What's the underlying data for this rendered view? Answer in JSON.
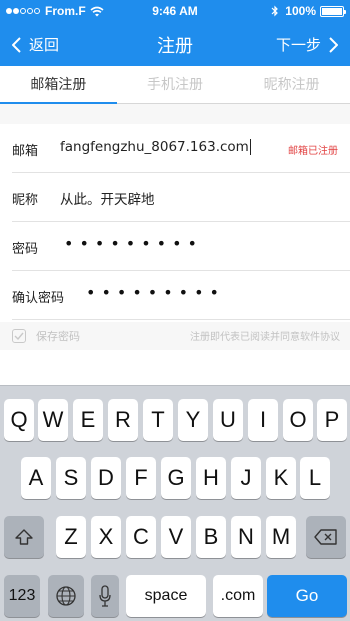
{
  "status_bar": {
    "carrier": "From.F",
    "time": "9:46 AM",
    "battery": "100%"
  },
  "nav": {
    "back_label": "返回",
    "title": "注册",
    "next_label": "下一步"
  },
  "tabs": [
    {
      "label": "邮箱注册",
      "active": true
    },
    {
      "label": "手机注册",
      "active": false
    },
    {
      "label": "昵称注册",
      "active": false
    }
  ],
  "form": {
    "email": {
      "label": "邮箱",
      "value": "fangfengzhu_8067.163.com",
      "error": "邮箱已注册"
    },
    "nickname": {
      "label": "昵称",
      "value": "从此。开天辟地"
    },
    "password": {
      "label": "密码",
      "value": "•••••••••"
    },
    "confirm": {
      "label": "确认密码",
      "value": "•••••••••"
    }
  },
  "save_password": {
    "label": "保存密码",
    "checked": true,
    "agreement": "注册即代表已阅读并同意软件协议"
  },
  "keyboard": {
    "row1": [
      "Q",
      "W",
      "E",
      "R",
      "T",
      "Y",
      "U",
      "I",
      "O",
      "P"
    ],
    "row2": [
      "A",
      "S",
      "D",
      "F",
      "G",
      "H",
      "J",
      "K",
      "L"
    ],
    "row3": [
      "Z",
      "X",
      "C",
      "V",
      "B",
      "N",
      "M"
    ],
    "numbers_label": "123",
    "space_label": "space",
    "dotcom_label": ".com",
    "go_label": "Go"
  },
  "colors": {
    "accent": "#1f8ded",
    "error": "#e24242",
    "keyboard_bg": "#cfd3d9"
  }
}
